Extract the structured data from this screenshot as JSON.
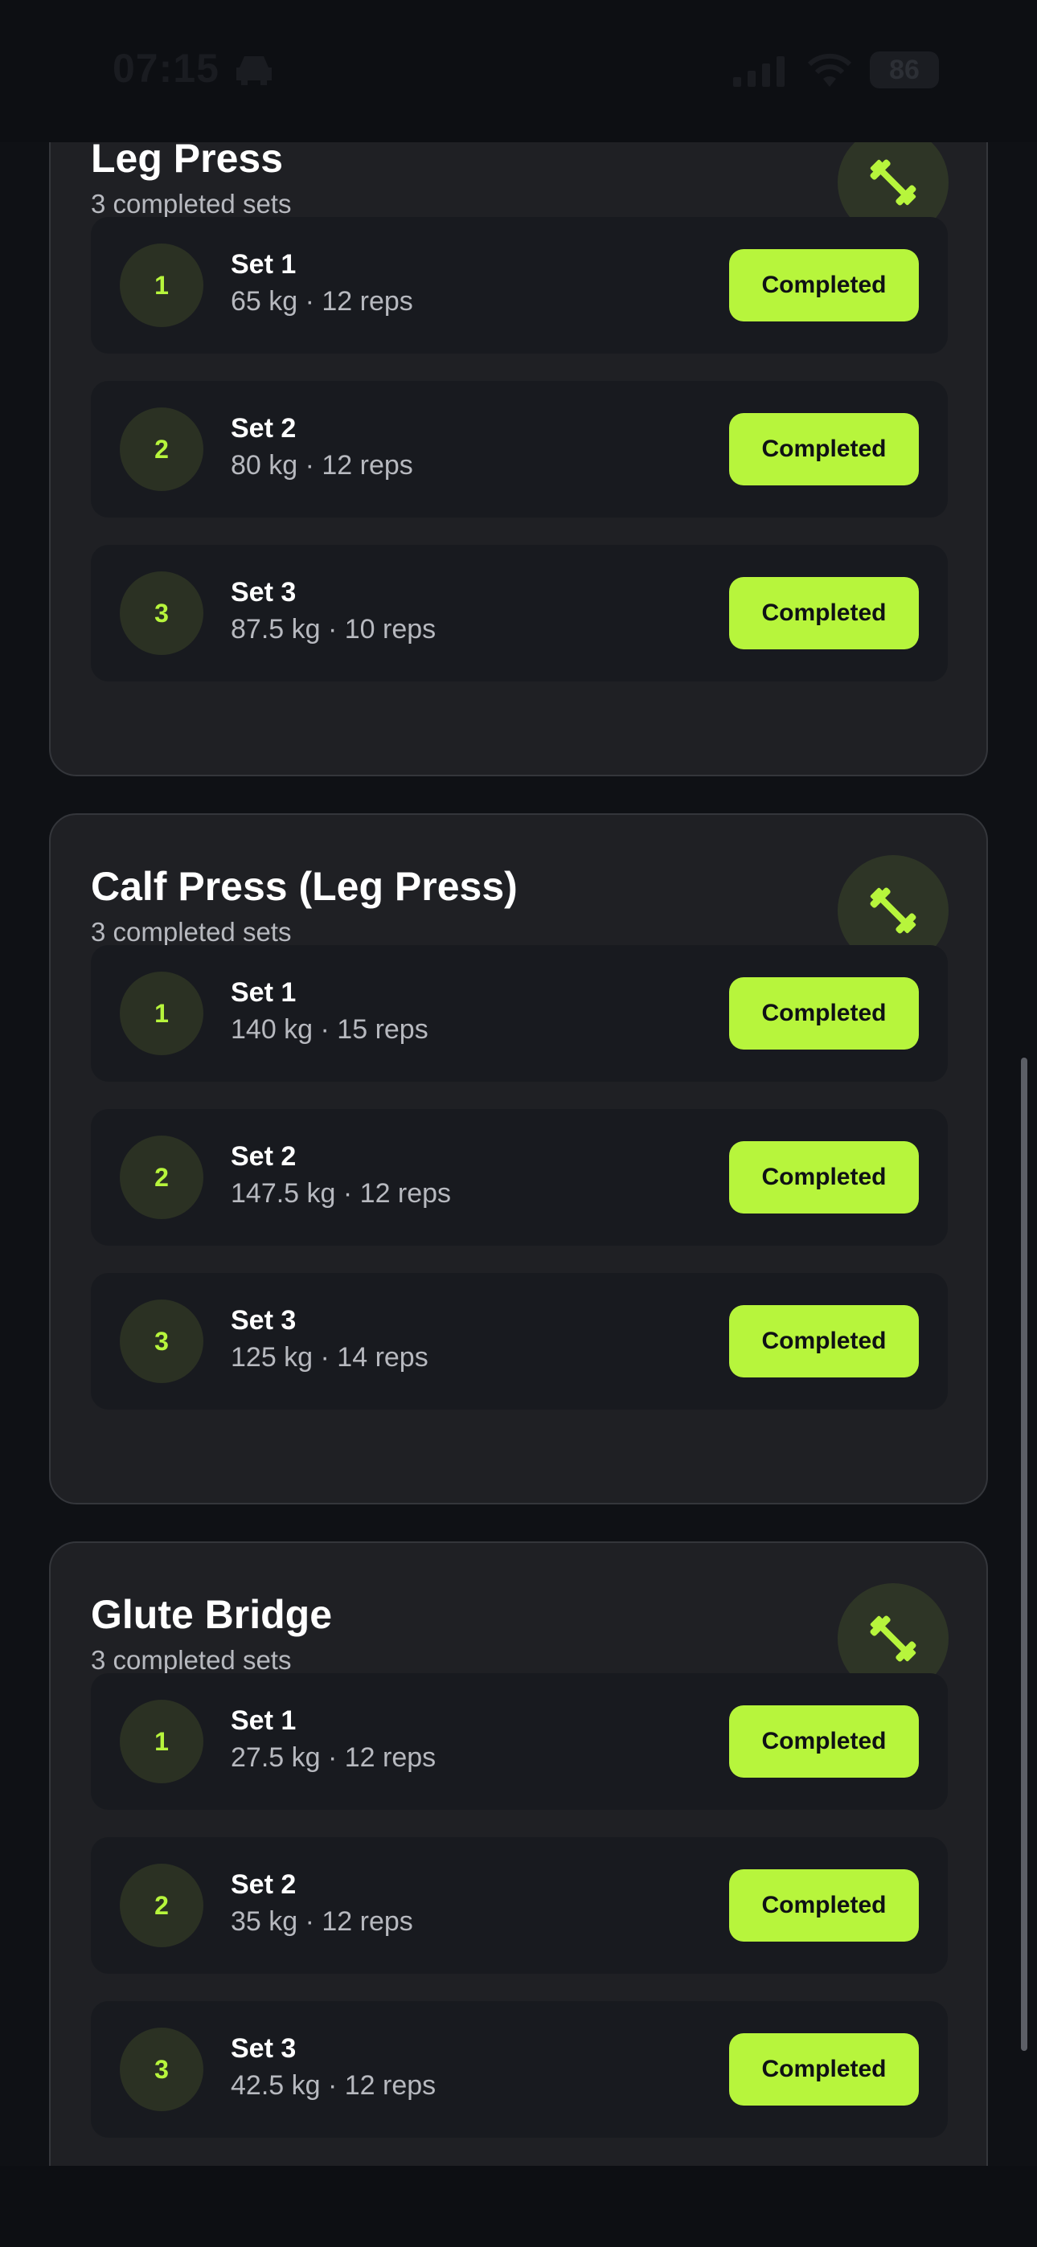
{
  "status_bar": {
    "time": "07:15",
    "battery": "86",
    "icons": [
      "car-icon",
      "cellular-signal-icon",
      "wifi-icon",
      "battery-icon"
    ]
  },
  "exercise_icon": "dumbbell-icon",
  "colors": {
    "accent": "#b7f53c",
    "card": "#1f2024",
    "row": "#181a1f",
    "background": "#0f1115",
    "muted_text": "#b7b9bf"
  },
  "exercises": [
    {
      "title": "Leg Press",
      "subtitle": "3 completed sets",
      "sets": [
        {
          "number": "1",
          "name": "Set 1",
          "detail": "65 kg · 12 reps",
          "status": "Completed"
        },
        {
          "number": "2",
          "name": "Set 2",
          "detail": "80 kg · 12 reps",
          "status": "Completed"
        },
        {
          "number": "3",
          "name": "Set 3",
          "detail": "87.5 kg · 10 reps",
          "status": "Completed"
        }
      ]
    },
    {
      "title": "Calf Press (Leg Press)",
      "subtitle": "3 completed sets",
      "sets": [
        {
          "number": "1",
          "name": "Set 1",
          "detail": "140 kg · 15 reps",
          "status": "Completed"
        },
        {
          "number": "2",
          "name": "Set 2",
          "detail": "147.5 kg · 12 reps",
          "status": "Completed"
        },
        {
          "number": "3",
          "name": "Set 3",
          "detail": "125 kg · 14 reps",
          "status": "Completed"
        }
      ]
    },
    {
      "title": "Glute Bridge",
      "subtitle": "3 completed sets",
      "sets": [
        {
          "number": "1",
          "name": "Set 1",
          "detail": "27.5 kg · 12 reps",
          "status": "Completed"
        },
        {
          "number": "2",
          "name": "Set 2",
          "detail": "35 kg · 12 reps",
          "status": "Completed"
        },
        {
          "number": "3",
          "name": "Set 3",
          "detail": "42.5 kg · 12 reps",
          "status": "Completed"
        }
      ]
    }
  ]
}
